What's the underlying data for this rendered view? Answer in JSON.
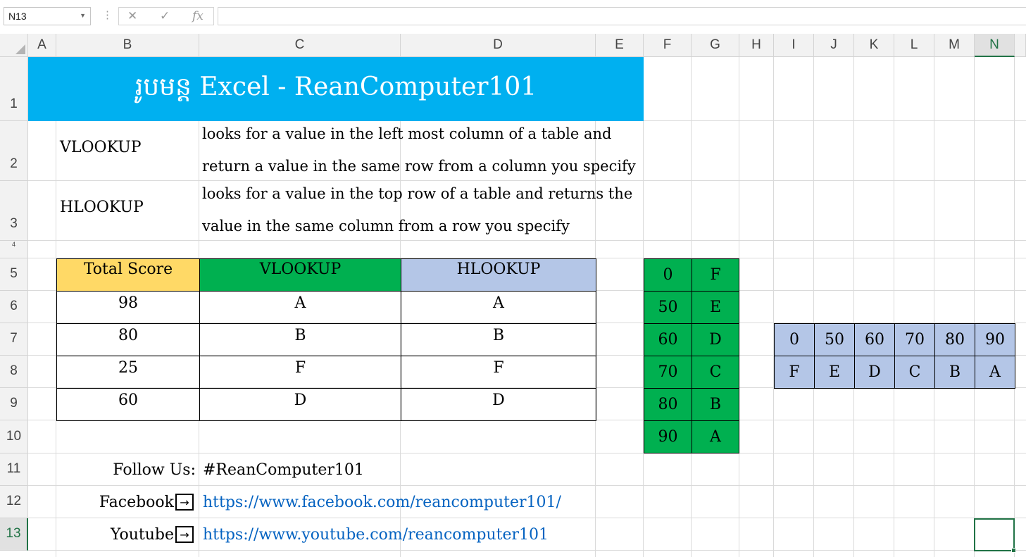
{
  "formula_bar": {
    "name_box": "N13",
    "formula": ""
  },
  "columns": [
    "A",
    "B",
    "C",
    "D",
    "E",
    "F",
    "G",
    "H",
    "I",
    "J",
    "K",
    "L",
    "M",
    "N"
  ],
  "rows": [
    "1",
    "2",
    "3",
    "4",
    "5",
    "6",
    "7",
    "8",
    "9",
    "10",
    "11",
    "12",
    "13"
  ],
  "sheet": {
    "title": "រូបមន្ត Excel - ReanComputer101",
    "vlookup_label": "VLOOKUP",
    "vlookup_desc_1": "looks for a value in the left most column of a table and",
    "vlookup_desc_2": "return a value in the same row from a column you specify",
    "hlookup_label": "HLOOKUP",
    "hlookup_desc_1": "looks for a value in the top row of a table and returns the",
    "hlookup_desc_2": "value in the same column from a row you specify",
    "table_headers": [
      "Total Score",
      "VLOOKUP",
      "HLOOKUP"
    ],
    "table_rows": [
      [
        "98",
        "A",
        "A"
      ],
      [
        "80",
        "B",
        "B"
      ],
      [
        "25",
        "F",
        "F"
      ],
      [
        "60",
        "D",
        "D"
      ]
    ],
    "vertical_lookup": [
      [
        "0",
        "F"
      ],
      [
        "50",
        "E"
      ],
      [
        "60",
        "D"
      ],
      [
        "70",
        "C"
      ],
      [
        "80",
        "B"
      ],
      [
        "90",
        "A"
      ]
    ],
    "horizontal_lookup": {
      "scores": [
        "0",
        "50",
        "60",
        "70",
        "80",
        "90"
      ],
      "grades": [
        "F",
        "E",
        "D",
        "C",
        "B",
        "A"
      ]
    },
    "follow_label": "Follow Us:",
    "follow_value": "#ReanComputer101",
    "facebook_label": "Facebook",
    "facebook_url": "https://www.facebook.com/reancomputer101/",
    "youtube_label": "Youtube",
    "youtube_url": "https://www.youtube.com/reancomputer101",
    "arrow_glyph": "→"
  },
  "colors": {
    "title_bg": "#00b0f0",
    "total_score_bg": "#ffd966",
    "vlookup_bg": "#00b050",
    "hlookup_bg": "#b4c6e7",
    "link": "#0563c1",
    "selection": "#217346"
  }
}
